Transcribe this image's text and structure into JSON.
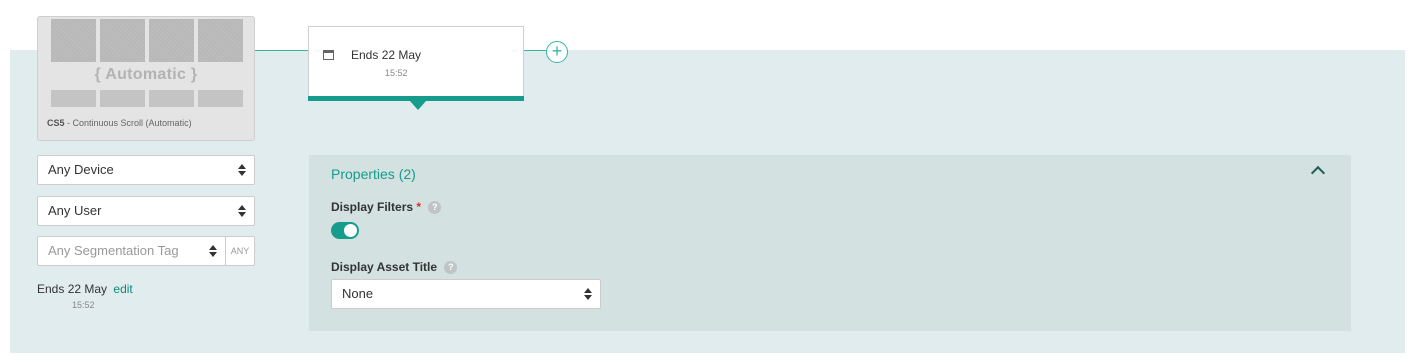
{
  "layout_card": {
    "auto_text": "{ Automatic }",
    "caption_code": "CS5",
    "caption_text": " - Continuous Scroll (Automatic)"
  },
  "filters": {
    "device": "Any Device",
    "user": "Any User",
    "segmentation_placeholder": "Any Segmentation Tag",
    "any_button": "ANY"
  },
  "schedule_left": {
    "label": "Ends",
    "date": "22 May",
    "edit": "edit",
    "time": "15:52"
  },
  "schedule_card": {
    "label": "Ends",
    "date": "22 May",
    "time": "15:52",
    "add_symbol": "+"
  },
  "properties": {
    "title": "Properties (2)",
    "display_filters_label": "Display Filters",
    "required_mark": "*",
    "help_symbol": "?",
    "display_filters_on": true,
    "display_asset_title_label": "Display Asset Title",
    "display_asset_title_value": "None"
  },
  "colors": {
    "accent": "#159c8c",
    "band": "#e0eced",
    "panel": "#d3e1e1",
    "required": "#e0302a"
  },
  "icons": [
    "calendar-icon",
    "plus-circle-icon",
    "chevron-up-icon",
    "help-icon",
    "select-arrows-icon"
  ]
}
